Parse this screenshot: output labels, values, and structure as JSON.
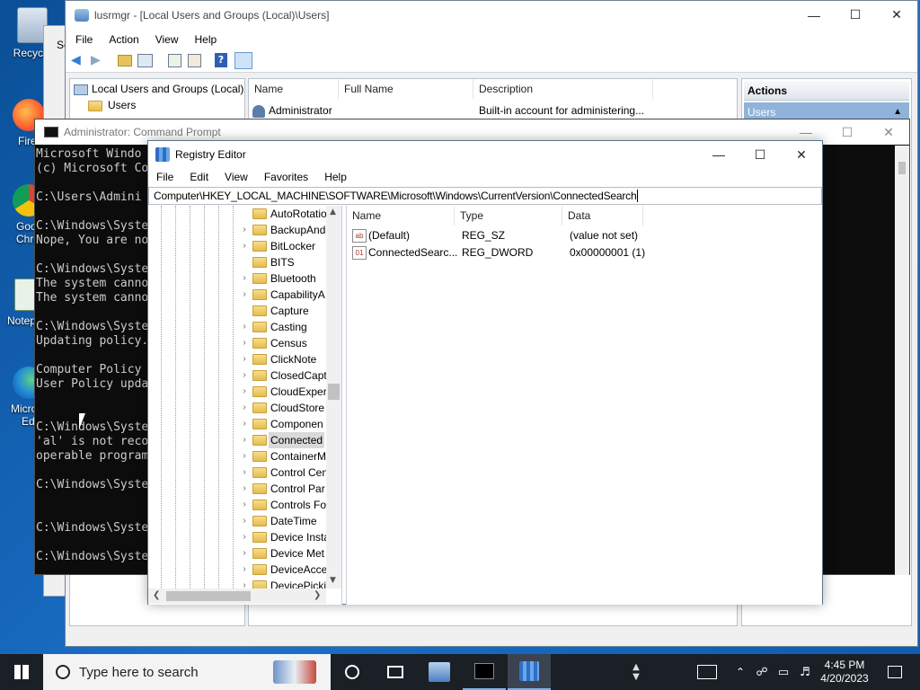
{
  "desktop": {
    "icons": [
      {
        "label": "Recycle",
        "icon": "recycle-bin-icon"
      },
      {
        "label": "Fire",
        "icon": "firefox-icon"
      },
      {
        "label": "Goo",
        "sub": "Chro",
        "icon": "chrome-icon"
      },
      {
        "label": "Notep",
        "icon": "notepad-icon"
      },
      {
        "label": "Micro",
        "sub": "Ed",
        "icon": "edge-icon"
      }
    ]
  },
  "lusrmgr": {
    "title": "lusrmgr - [Local Users and Groups (Local)\\Users]",
    "menu": [
      "File",
      "Action",
      "View",
      "Help"
    ],
    "tree": [
      {
        "label": "Local Users and Groups (Local)"
      },
      {
        "label": "Users"
      }
    ],
    "columns": [
      "Name",
      "Full Name",
      "Description"
    ],
    "rows": [
      {
        "name": "Administrator",
        "full_name": "",
        "description": "Built-in account for administering..."
      }
    ],
    "actions_header": "Actions",
    "actions_sub": "Users",
    "behind_fragment": "Se"
  },
  "cmd": {
    "title": "Administrator: Command Prompt",
    "lines": [
      "Microsoft Windo",
      "(c) Microsoft Co",
      "",
      "C:\\Users\\Admini",
      "",
      "C:\\Windows\\Syste",
      "Nope, You are no",
      "",
      "C:\\Windows\\Syste",
      "The system canno",
      "The system canno",
      "",
      "C:\\Windows\\Syste",
      "Updating policy.",
      "",
      "Computer Policy ",
      "User Policy upda",
      "",
      "",
      "C:\\Windows\\Syste",
      "'al' is not reco",
      "operable program",
      "",
      "C:\\Windows\\Syste",
      "",
      "",
      "C:\\Windows\\Syste",
      "",
      "C:\\Windows\\Syste"
    ]
  },
  "regedit": {
    "title": "Registry Editor",
    "menu": [
      "File",
      "Edit",
      "View",
      "Favorites",
      "Help"
    ],
    "address": "Computer\\HKEY_LOCAL_MACHINE\\SOFTWARE\\Microsoft\\Windows\\CurrentVersion\\ConnectedSearch",
    "tree_items": [
      {
        "label": "AutoRotatio",
        "expandable": false
      },
      {
        "label": "BackupAnd",
        "expandable": true
      },
      {
        "label": "BitLocker",
        "expandable": true
      },
      {
        "label": "BITS",
        "expandable": false
      },
      {
        "label": "Bluetooth",
        "expandable": true
      },
      {
        "label": "CapabilityA",
        "expandable": true
      },
      {
        "label": "Capture",
        "expandable": false
      },
      {
        "label": "Casting",
        "expandable": true
      },
      {
        "label": "Census",
        "expandable": true
      },
      {
        "label": "ClickNote",
        "expandable": true
      },
      {
        "label": "ClosedCapt",
        "expandable": true
      },
      {
        "label": "CloudExper",
        "expandable": true
      },
      {
        "label": "CloudStore",
        "expandable": true
      },
      {
        "label": "Componen",
        "expandable": true
      },
      {
        "label": "Connected",
        "expandable": true,
        "selected": true
      },
      {
        "label": "ContainerM",
        "expandable": true
      },
      {
        "label": "Control Cen",
        "expandable": true
      },
      {
        "label": "Control Par",
        "expandable": true
      },
      {
        "label": "Controls Fo",
        "expandable": true
      },
      {
        "label": "DateTime",
        "expandable": true
      },
      {
        "label": "Device Insta",
        "expandable": true
      },
      {
        "label": "Device Met",
        "expandable": true
      },
      {
        "label": "DeviceAcce",
        "expandable": true
      },
      {
        "label": "DevicePicki",
        "expandable": true
      }
    ],
    "columns": [
      "Name",
      "Type",
      "Data"
    ],
    "values": [
      {
        "name": "(Default)",
        "type": "REG_SZ",
        "data": "(value not set)",
        "icon": "string-value-icon"
      },
      {
        "name": "ConnectedSearc...",
        "type": "REG_DWORD",
        "data": "0x00000001 (1)",
        "icon": "binary-value-icon"
      }
    ]
  },
  "taskbar": {
    "search_placeholder": "Type here to search",
    "time": "4:45 PM",
    "date": "4/20/2023"
  }
}
